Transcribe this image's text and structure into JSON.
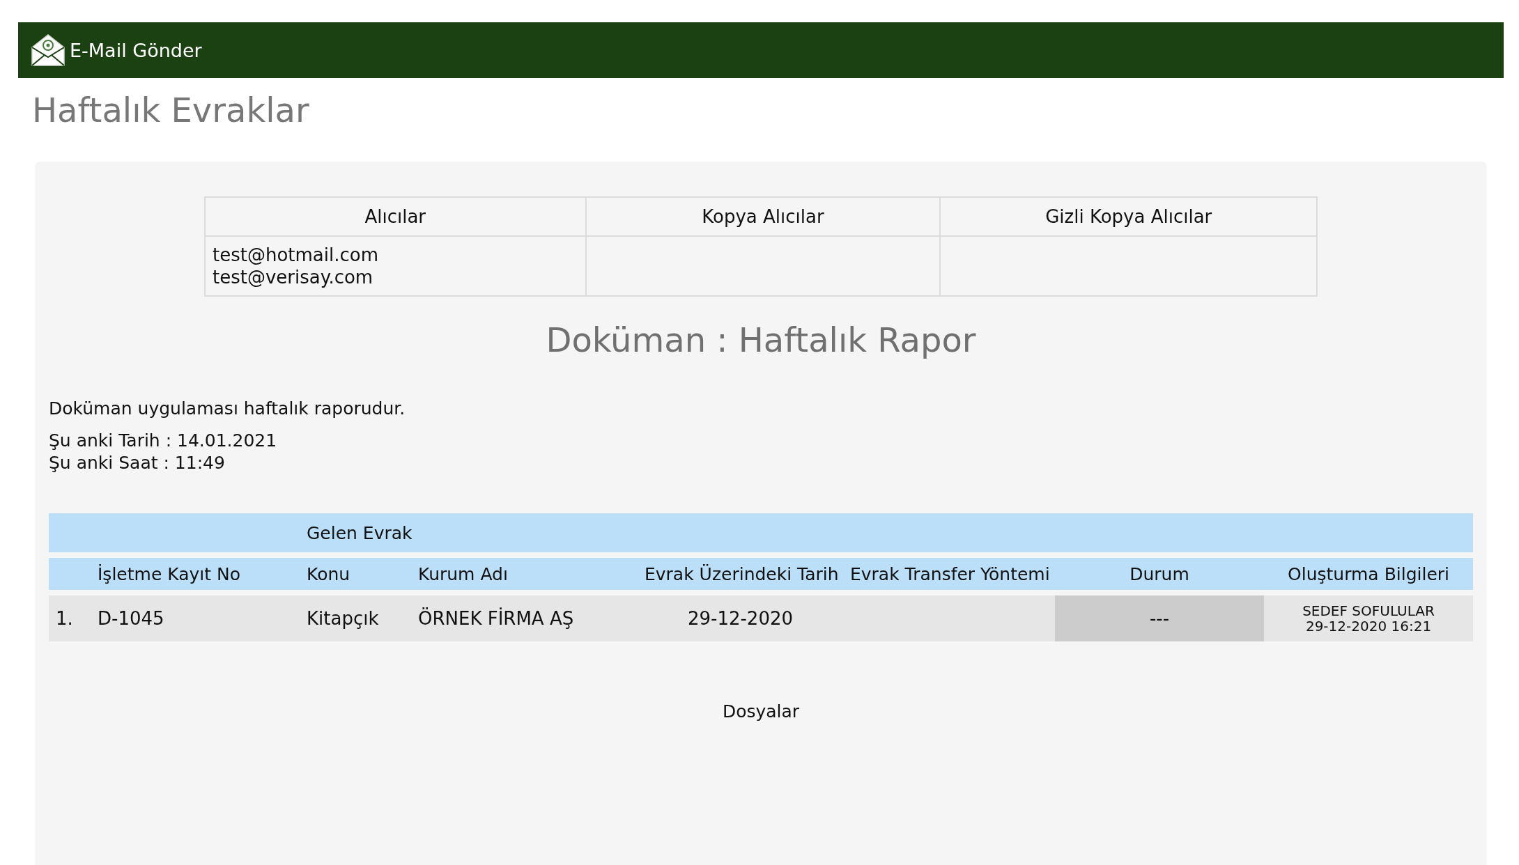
{
  "header": {
    "title": "E-Mail Gönder"
  },
  "page_title": "Haftalık Evraklar",
  "recipients": [
    {
      "heading": "Alıcılar",
      "addresses": [
        "test@hotmail.com",
        "test@verisay.com"
      ]
    },
    {
      "heading": "Kopya Alıcılar"
    },
    {
      "heading": "Gizli Kopya Alıcılar"
    }
  ],
  "document_title": "Doküman : Haftalık Rapor",
  "description": "Doküman uygulaması haftalık raporudur.",
  "info_lines": [
    "Şu anki Tarih : 14.01.2021",
    "Şu anki Saat : 11:49"
  ],
  "report_table": {
    "group_label": "Gelen Evrak",
    "columns": [
      "İşletme Kayıt No",
      "Konu",
      "Kurum Adı",
      "Evrak Üzerindeki Tarih",
      "Evrak Transfer Yöntemi",
      "Durum",
      "Oluşturma Bilgileri"
    ],
    "rows": [
      {
        "index": "1.",
        "registry_no": "D-1045",
        "subject": "Kitapçık",
        "institution": "ÖRNEK FİRMA AŞ",
        "document_date": "29-12-2020",
        "status": "---",
        "created_by": "SEDEF SOFULULAR",
        "created_at": "29-12-2020 16:21"
      }
    ]
  },
  "files_heading": "Dosyalar"
}
